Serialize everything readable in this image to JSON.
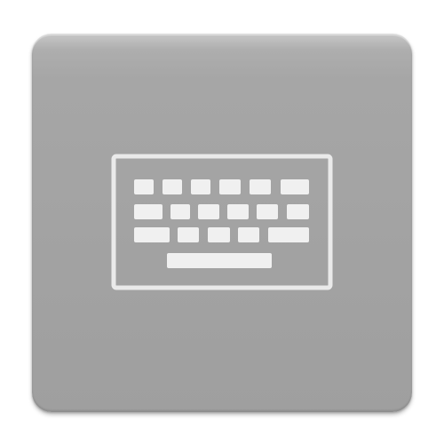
{
  "app_icon": {
    "icon": "keyboard-icon",
    "colors": {
      "background": "#ffffff",
      "tile": "#a5a5a5",
      "glyph": "#f2f2f2"
    }
  }
}
